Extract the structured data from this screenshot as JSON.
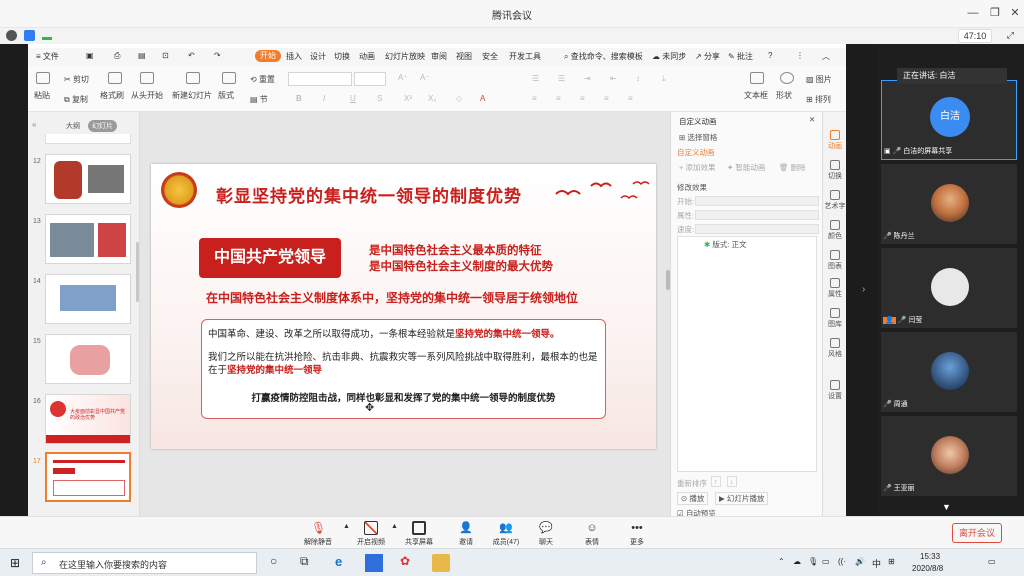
{
  "window": {
    "title": "腾讯会议",
    "timer": "47:10"
  },
  "wps": {
    "menu": [
      "文件",
      "开始",
      "插入",
      "设计",
      "切换",
      "动画",
      "幻灯片放映",
      "审阅",
      "视图",
      "安全",
      "开发工具"
    ],
    "search": "查找命令、搜索模板",
    "right": [
      "未同步",
      "分享",
      "批注"
    ],
    "ribbon": {
      "paste": "粘贴",
      "cut": "剪切",
      "copy": "复制",
      "format_painter": "格式刷",
      "from_start": "从头开始",
      "new_slide": "新建幻灯片",
      "layout": "版式",
      "reset": "重置",
      "section": "节",
      "textbox": "文本框",
      "shape": "形状",
      "picture": "图片",
      "arrange": "排列"
    }
  },
  "thumbs": {
    "tabs": [
      "大纲",
      "幻灯片"
    ],
    "numbers": [
      "12",
      "13",
      "14",
      "15",
      "16",
      "17"
    ],
    "slide16_text": "大疫面前彰显中国共产党的政治优势"
  },
  "slide": {
    "title": "彰显坚持党的集中统一领导的制度优势",
    "box_label": "中国共产党领导",
    "feature1": "是中国特色社会主义最本质的特征",
    "feature2": "是中国特色社会主义制度的最大优势",
    "middle": "在中国特色社会主义制度体系中，坚持党的集中统一领导居于统领地位",
    "para1_a": "中国革命、建设、改革之所以取得成功，一条根本经验就是",
    "para1_b": "坚持党的集中统一领导。",
    "para2_a": "我们之所以能在抗洪抢险、抗击非典、抗震救灾等一系列风险挑战中取得胜利，最根本的也是在于",
    "para2_b": "坚持党的集中统一领导",
    "para3": "打赢疫情防控阻击战，同样也彰显和发挥了党的集中统一领导的制度优势"
  },
  "anim_pane": {
    "title": "自定义动画",
    "select_pane": "选择窗格",
    "custom": "自定义动画",
    "add_effect": "添加效果",
    "smart_anim": "智能动画",
    "delete": "删除",
    "modify": "修改效果",
    "start": "开始:",
    "property": "属性:",
    "speed": "速度:",
    "item": "版式: 正文",
    "reorder": "重新排序",
    "play": "播放",
    "slideshow": "幻灯片播放",
    "autopreview": "自动预览"
  },
  "right_tools": [
    "动画",
    "切换",
    "艺术字",
    "颜色",
    "图表",
    "属性",
    "图库",
    "风格",
    "设置"
  ],
  "meeting": {
    "speaking": "正在讲话: 白洁",
    "participants": [
      {
        "name": "白洁的屏幕共享",
        "avatar_text": "白洁"
      },
      {
        "name": "陈丹兰"
      },
      {
        "name": "闫莹"
      },
      {
        "name": "周通"
      },
      {
        "name": "王亚丽"
      }
    ]
  },
  "toolbar": {
    "items": [
      "解除静音",
      "开启视频",
      "共享屏幕",
      "邀请",
      "成员(47)",
      "聊天",
      "表情",
      "更多"
    ],
    "leave": "离开会议"
  },
  "taskbar": {
    "search_placeholder": "在这里输入你要搜索的内容",
    "ime": "中",
    "time": "15:33",
    "date": "2020/8/8"
  }
}
